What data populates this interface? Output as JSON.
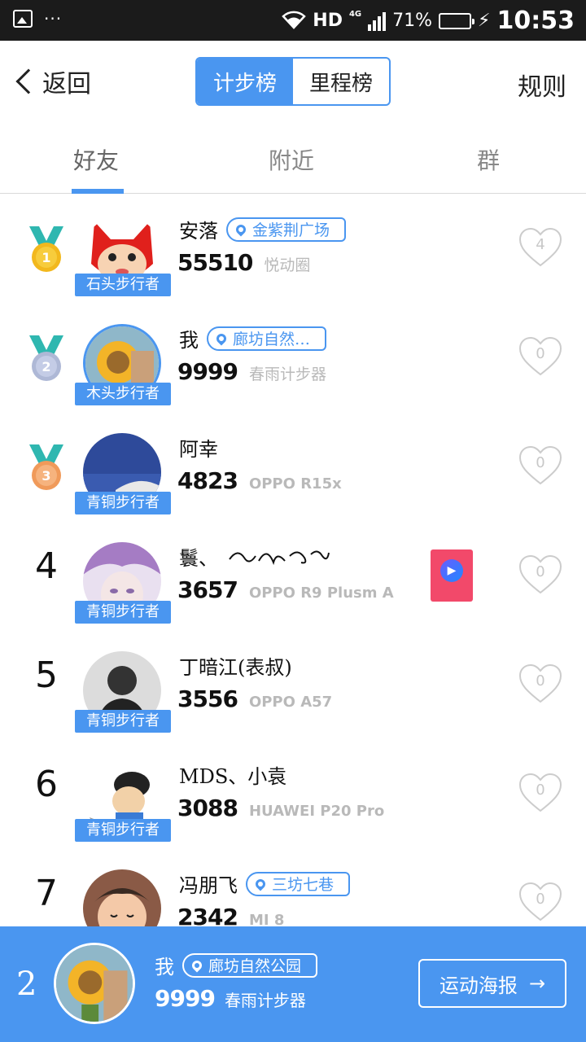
{
  "status_bar": {
    "gallery_icon": "image-icon",
    "more_dots": "···",
    "hd": "HD",
    "signal_label": "4G",
    "battery_percent": "71%",
    "battery_level": 0.71,
    "time": "10:53"
  },
  "header": {
    "back_label": "返回",
    "segments": [
      "计步榜",
      "里程榜"
    ],
    "active_segment": 0,
    "rules_label": "规则"
  },
  "tabs": {
    "items": [
      "好友",
      "附近",
      "群"
    ],
    "active": 0
  },
  "rows": [
    {
      "rank": "1",
      "medal": "gold",
      "name": "安落",
      "location": "金紫荆广场",
      "steps": "55510",
      "device": "悦动圈",
      "badge": "石头步行者",
      "likes": "4"
    },
    {
      "rank": "2",
      "medal": "silver",
      "name": "我",
      "location": "廊坊自然…",
      "steps": "9999",
      "device": "春雨计步器",
      "badge": "木头步行者",
      "likes": "0"
    },
    {
      "rank": "3",
      "medal": "bronze",
      "name": "阿幸",
      "location": "",
      "steps": "4823",
      "device": "OPPO R15x",
      "badge": "青铜步行者",
      "likes": "0"
    },
    {
      "rank": "4",
      "medal": "",
      "name": "鬟、",
      "location": "",
      "steps": "3657",
      "device": "OPPO R9 Plusm A",
      "badge": "青铜步行者",
      "likes": "0"
    },
    {
      "rank": "5",
      "medal": "",
      "name": "丁暗江(表叔)",
      "location": "",
      "steps": "3556",
      "device": "OPPO A57",
      "badge": "青铜步行者",
      "likes": "0"
    },
    {
      "rank": "6",
      "medal": "",
      "name": "MDS、小袁",
      "location": "",
      "steps": "3088",
      "device": "HUAWEI P20 Pro",
      "badge": "青铜步行者",
      "likes": "0"
    },
    {
      "rank": "7",
      "medal": "",
      "name": "冯朋飞",
      "location": "三坊七巷",
      "steps": "2342",
      "device": "MI 8",
      "badge": "",
      "likes": "0"
    }
  ],
  "red_packet_icon": "play-icon",
  "my_entry": {
    "rank": "2",
    "name": "我",
    "location": "廊坊自然公园",
    "steps": "9999",
    "device": "春雨计步器",
    "poster_label": "运动海报",
    "poster_arrow": "→"
  },
  "colors": {
    "accent": "#4a96f0",
    "gold": "#f2b81d",
    "silver": "#aeb8d6",
    "bronze": "#f09a5a",
    "medal_ribbon": "#2fb7b0",
    "red_packet": "#f2496a"
  }
}
